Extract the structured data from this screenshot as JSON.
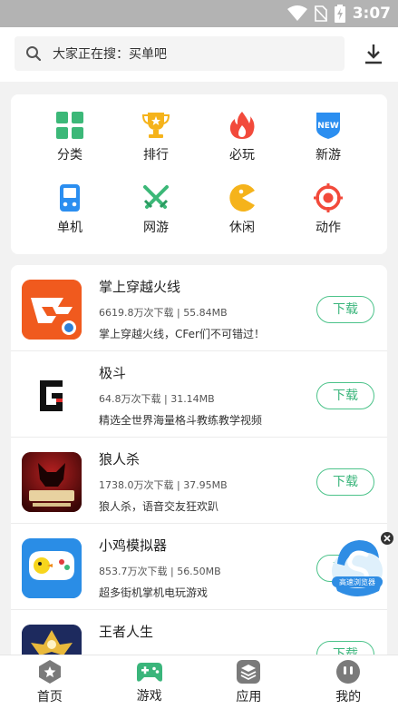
{
  "status_bar": {
    "time": "3:07"
  },
  "search": {
    "placeholder_text": "大家正在搜：买单吧"
  },
  "categories": [
    {
      "label": "分类",
      "icon": "grid-icon",
      "color": "#3cb878"
    },
    {
      "label": "排行",
      "icon": "trophy-icon",
      "color": "#f5b31b"
    },
    {
      "label": "必玩",
      "icon": "flame-icon",
      "color": "#f24a3b"
    },
    {
      "label": "新游",
      "icon": "new-badge-icon",
      "color": "#2b8ef0",
      "badge": "NEW"
    },
    {
      "label": "单机",
      "icon": "gamepad-device-icon",
      "color": "#2b8ef0"
    },
    {
      "label": "网游",
      "icon": "swords-icon",
      "color": "#3cb878"
    },
    {
      "label": "休闲",
      "icon": "pacman-icon",
      "color": "#f5b31b"
    },
    {
      "label": "动作",
      "icon": "target-icon",
      "color": "#f24a3b"
    }
  ],
  "apps": [
    {
      "name": "掌上穿越火线",
      "meta": "6619.8万次下载 | 55.84MB",
      "desc": "掌上穿越火线，CFer们不可错过！",
      "button": "下载"
    },
    {
      "name": "极斗",
      "meta": "64.8万次下载 | 31.14MB",
      "desc": "精选全世界海量格斗教练教学视频",
      "button": "下载"
    },
    {
      "name": "狼人杀",
      "meta": "1738.0万次下载 | 37.95MB",
      "desc": "狼人杀，语音交友狂欢趴",
      "button": "下载"
    },
    {
      "name": "小鸡模拟器",
      "meta": "853.7万次下载 | 56.50MB",
      "desc": "超多街机掌机电玩游戏",
      "button": "下载"
    },
    {
      "name": "王者人生",
      "meta": "",
      "desc": "",
      "button": "下载"
    }
  ],
  "float_ad": {
    "label": "高速浏览器"
  },
  "tabs": [
    {
      "label": "首页",
      "icon": "home-star-icon",
      "active": false
    },
    {
      "label": "游戏",
      "icon": "game-controller-icon",
      "active": true
    },
    {
      "label": "应用",
      "icon": "apps-layers-icon",
      "active": false
    },
    {
      "label": "我的",
      "icon": "profile-face-icon",
      "active": false
    }
  ],
  "colors": {
    "accent": "#3ab57b",
    "statusbar": "#b3b3b3"
  }
}
